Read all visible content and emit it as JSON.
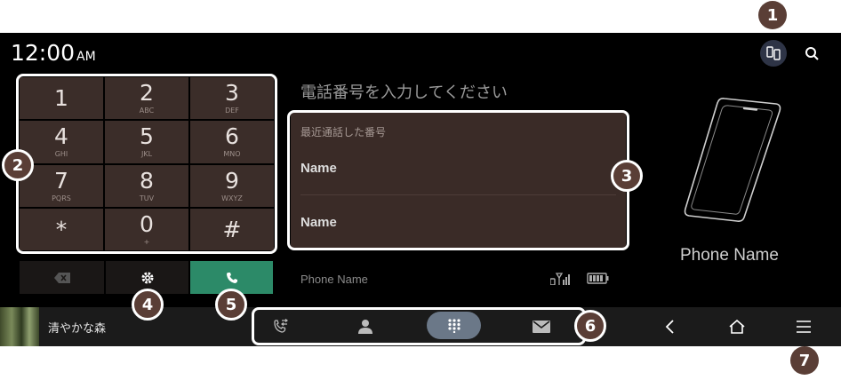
{
  "status_bar": {
    "time": "12:00",
    "ampm": "AM"
  },
  "top_icons": {
    "switch_device": "phone-switch-icon",
    "search": "search-icon"
  },
  "keypad": [
    {
      "digit": "1",
      "letters": ""
    },
    {
      "digit": "2",
      "letters": "ABC"
    },
    {
      "digit": "3",
      "letters": "DEF"
    },
    {
      "digit": "4",
      "letters": "GHI"
    },
    {
      "digit": "5",
      "letters": "JKL"
    },
    {
      "digit": "6",
      "letters": "MNO"
    },
    {
      "digit": "7",
      "letters": "PQRS"
    },
    {
      "digit": "8",
      "letters": "TUV"
    },
    {
      "digit": "9",
      "letters": "WXYZ"
    },
    {
      "digit": "*",
      "letters": ""
    },
    {
      "digit": "0",
      "letters": "+"
    },
    {
      "digit": "#",
      "letters": ""
    }
  ],
  "actions": {
    "backspace": "backspace-icon",
    "settings": "gear-icon",
    "call": "phone-icon"
  },
  "dial": {
    "prompt": "電話番号を入力してください",
    "recent_header": "最近通話した番号",
    "recent": [
      "Name",
      "Name"
    ]
  },
  "status": {
    "phone_name": "Phone Name",
    "signal": "signal-icon",
    "battery": "battery-icon"
  },
  "device": {
    "phone_name": "Phone Name"
  },
  "media": {
    "title": "清やかな森"
  },
  "tabs": [
    "call-history-icon",
    "contacts-icon",
    "keypad-icon",
    "message-icon"
  ],
  "nav": [
    "back-icon",
    "home-icon",
    "menu-icon"
  ],
  "callouts": [
    "1",
    "2",
    "3",
    "4",
    "5",
    "6",
    "7"
  ],
  "colors": {
    "call_green": "#2c8a68",
    "key_bg": "#3b2d29",
    "badge_bg": "#5a3e36",
    "screen_bg": "#000000"
  }
}
